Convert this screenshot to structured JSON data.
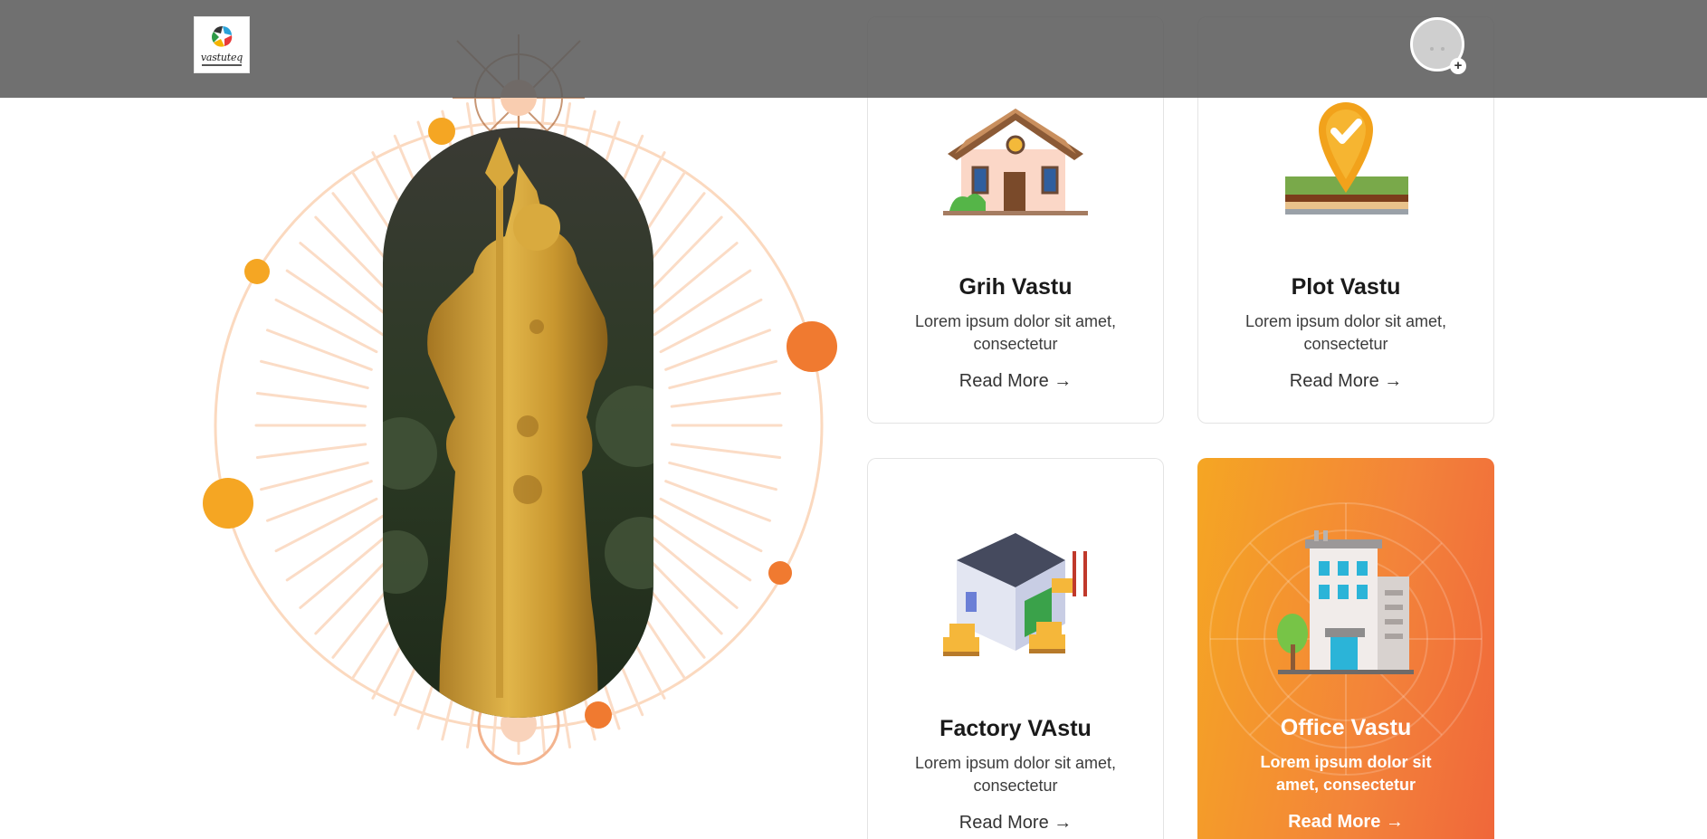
{
  "header": {
    "logo_text": "vastuteq",
    "logo_icon": "swirl-logo-icon",
    "avatar_icon": "user-avatar-icon",
    "avatar_badge": "+"
  },
  "hero": {
    "image": "golden-deity-statue-image",
    "decoration": "orbit-rays-illustration"
  },
  "colors": {
    "accent_orange": "#f0673a",
    "accent_yellow": "#f5a623",
    "topbar": "#5c5c5c"
  },
  "cards": [
    {
      "title": "Grih Vastu",
      "desc": "Lorem ipsum dolor sit amet, consectetur",
      "link": "Read More →",
      "icon": "house-icon"
    },
    {
      "title": "Plot Vastu",
      "desc": "Lorem ipsum dolor sit amet, consectetur",
      "link": "Read More →",
      "icon": "plot-pin-icon"
    },
    {
      "title": "Factory VAstu",
      "desc": "Lorem ipsum dolor sit amet, consectetur",
      "link": "Read More →",
      "icon": "factory-icon"
    },
    {
      "title": "Office Vastu",
      "desc": "Lorem ipsum dolor sit amet, consectetur",
      "link": "Read More →",
      "icon": "office-building-icon"
    }
  ]
}
